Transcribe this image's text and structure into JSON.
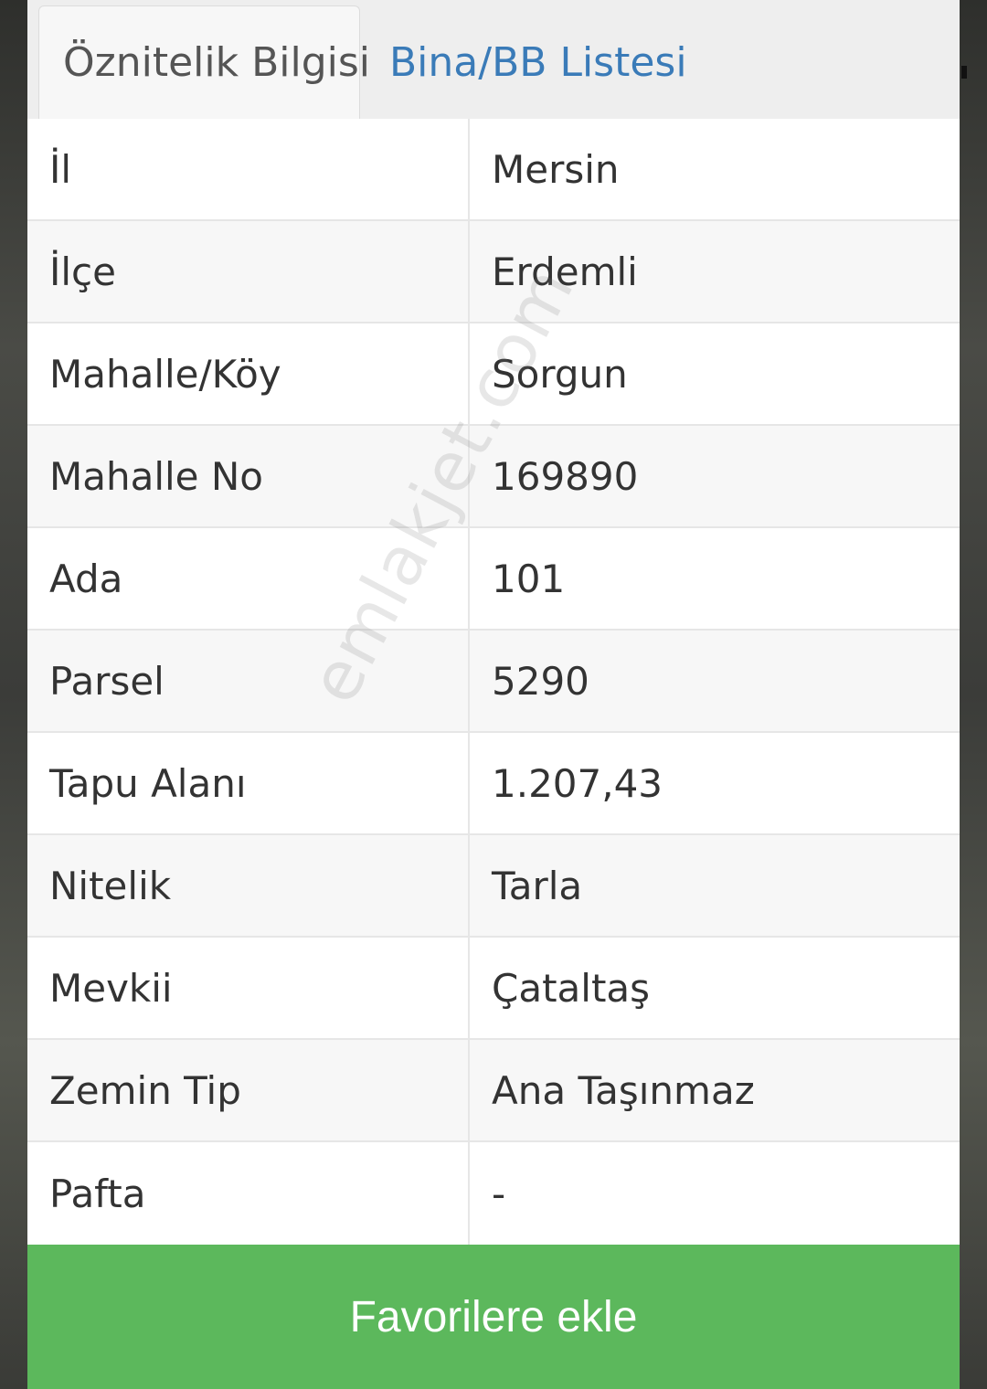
{
  "tabs": {
    "active_label": "Öznitelik Bilgisi",
    "other_label": "Bina/BB Listesi"
  },
  "attributes": [
    {
      "label": "İl",
      "value": "Mersin"
    },
    {
      "label": "İlçe",
      "value": "Erdemli"
    },
    {
      "label": "Mahalle/Köy",
      "value": "Sorgun"
    },
    {
      "label": "Mahalle No",
      "value": "169890"
    },
    {
      "label": "Ada",
      "value": "101"
    },
    {
      "label": "Parsel",
      "value": "5290"
    },
    {
      "label": "Tapu Alanı",
      "value": "1.207,43"
    },
    {
      "label": "Nitelik",
      "value": "Tarla"
    },
    {
      "label": "Mevkii",
      "value": "Çataltaş"
    },
    {
      "label": "Zemin Tip",
      "value": "Ana Taşınmaz"
    },
    {
      "label": "Pafta",
      "value": "-"
    }
  ],
  "watermark": "emlakjet.com",
  "actions": {
    "favorite_label": "Favorilere ekle"
  },
  "colors": {
    "accent_green": "#5cb85c",
    "tab_link_blue": "#3a7bb8"
  }
}
